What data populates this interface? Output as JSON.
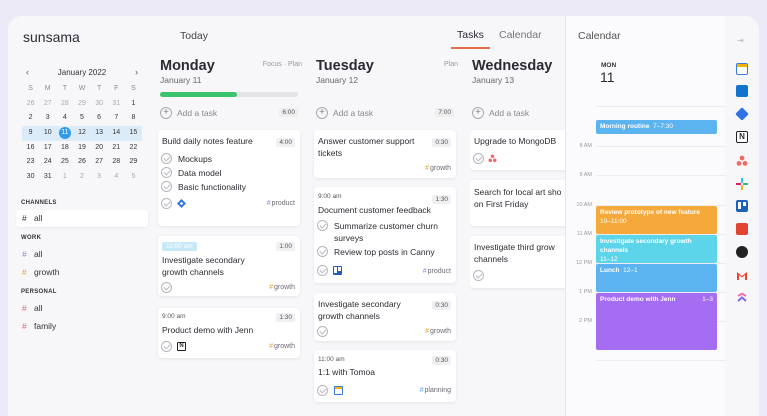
{
  "brand": "sunsama",
  "header": {
    "today": "Today",
    "tabs": [
      "Tasks",
      "Calendar"
    ],
    "calendar_title": "Calendar"
  },
  "mini_calendar": {
    "month": "January 2022",
    "prev": "‹",
    "next": "›",
    "weekdays": [
      "S",
      "M",
      "T",
      "W",
      "T",
      "F",
      "S"
    ],
    "weeks": [
      [
        "26",
        "27",
        "28",
        "29",
        "30",
        "31",
        "1"
      ],
      [
        "2",
        "3",
        "4",
        "5",
        "6",
        "7",
        "8"
      ],
      [
        "9",
        "10",
        "11",
        "12",
        "13",
        "14",
        "15"
      ],
      [
        "16",
        "17",
        "18",
        "19",
        "20",
        "21",
        "22"
      ],
      [
        "23",
        "24",
        "25",
        "26",
        "27",
        "28",
        "29"
      ],
      [
        "30",
        "31",
        "1",
        "2",
        "3",
        "4",
        "5"
      ]
    ]
  },
  "sidebar": {
    "sections": [
      {
        "title": "CHANNELS",
        "items": [
          {
            "label": "all",
            "color": "#2b2b33"
          }
        ]
      },
      {
        "title": "WORK",
        "items": [
          {
            "label": "all",
            "color": "#8a8ad6"
          },
          {
            "label": "growth",
            "color": "#e8a33b"
          }
        ]
      },
      {
        "title": "PERSONAL",
        "items": [
          {
            "label": "all",
            "color": "#e0607a"
          },
          {
            "label": "family",
            "color": "#e0607a"
          }
        ]
      }
    ]
  },
  "days": [
    {
      "name": "Monday",
      "date": "January 11",
      "extra_a": "Focus",
      "extra_b": "Plan",
      "progress": 0.56,
      "add_task": "Add a task",
      "add_duration": "6:00",
      "cards": [
        {
          "title": "Build daily notes feature",
          "duration": "4:00",
          "subtasks": [
            "Mockups",
            "Data model",
            "Basic functionality"
          ],
          "tag": "product"
        },
        {
          "time": "11:00 am",
          "title_lines": [
            "Investigate secondary",
            "growth channels"
          ],
          "duration": "1:00",
          "tag": "growth"
        },
        {
          "time": "9:00 am",
          "title_lines": [
            "Product demo with Jenn"
          ],
          "duration": "1:30",
          "tag": "growth"
        }
      ]
    },
    {
      "name": "Tuesday",
      "date": "January 12",
      "extra_a": "Plan",
      "add_task": "Add a task",
      "add_duration": "7:00",
      "cards": [
        {
          "title_lines": [
            "Answer customer support",
            "tickets"
          ],
          "duration": "0:30",
          "tag": "growth"
        },
        {
          "time": "9:00 am",
          "title_lines": [
            "Document customer feedback"
          ],
          "duration": "1:30",
          "subtasks": [
            "Summarize customer churn",
            "surveys",
            "Review top posts in Canny"
          ],
          "tag": "product"
        },
        {
          "title_lines": [
            "Investigate secondary",
            "growth channels"
          ],
          "duration": "0:30",
          "tag": "growth"
        },
        {
          "time": "11:00 am",
          "title_lines": [
            "1:1 with Tomoa"
          ],
          "duration": "0:30",
          "tag": "planning"
        }
      ]
    },
    {
      "name": "Wednesday",
      "date": "January 13",
      "add_task": "Add a task",
      "add_duration": "0:30",
      "cards": [
        {
          "title_lines": [
            "Upgrade to MongoDB"
          ],
          "duration": "0:30"
        },
        {
          "title_lines": [
            "Search for local art sho",
            "on First Friday"
          ]
        },
        {
          "title_lines": [
            "Investigate third grow",
            "channels"
          ]
        }
      ]
    }
  ],
  "calendar_panel": {
    "day_abbr": "MON",
    "day_num": "11",
    "hours": [
      "8 AM",
      "9 AM",
      "10 AM",
      "11 AM",
      "12 PM",
      "1 PM",
      "2 PM"
    ],
    "events": [
      {
        "title": "Morning routine",
        "time": "7–7:30",
        "color": "#5bb4f0"
      },
      {
        "title": "Review prototype of new feature",
        "time": "10–11:00",
        "color": "#f6a93b"
      },
      {
        "title": "Investigate secondary growth channels",
        "time": "11–12",
        "color": "#5cd5ea"
      },
      {
        "title": "Lunch",
        "time": "12–1",
        "color": "#5bb4f0"
      },
      {
        "title": "Product demo with Jenn",
        "time": "1–3",
        "color": "#a56df2"
      }
    ]
  },
  "integrations": [
    "calendar-icon",
    "outlook-icon",
    "jira-icon",
    "notion-icon",
    "asana-icon",
    "slack-icon",
    "trello-icon",
    "todoist-icon",
    "github-icon",
    "gmail-icon",
    "clickup-icon"
  ],
  "tag_colors": {
    "product": "#8a8ad6",
    "growth": "#e8a33b",
    "planning": "#5aa5e6"
  }
}
